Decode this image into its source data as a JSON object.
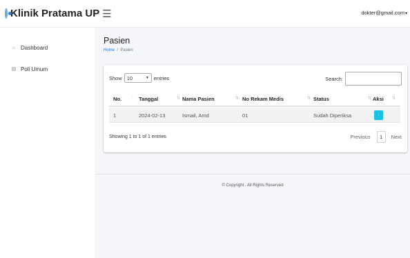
{
  "brand": {
    "name": "Klinik Pratama UP",
    "logo_icon": "clinic-logo-icon"
  },
  "header": {
    "menu_icon": "hamburger-icon",
    "user_email": "dokter@gmail.com",
    "caret": "▾"
  },
  "sidebar": {
    "items": [
      {
        "label": "Dashboard",
        "icon": "house-icon",
        "glyph": "⌂"
      },
      {
        "label": "Poli Umum",
        "icon": "document-icon",
        "glyph": "▤"
      }
    ]
  },
  "page": {
    "title": "Pasien",
    "breadcrumb": {
      "home": "Home",
      "separator": "/",
      "current": "Pasien"
    }
  },
  "table_controls": {
    "show_label": "Show",
    "length_value": "10",
    "entries_label": "entries",
    "search_label": "Search:",
    "search_value": ""
  },
  "table": {
    "columns": [
      "No.",
      "Tanggal",
      "Nama Pasien",
      "No Rekam Medis",
      "Status",
      "Aksi"
    ],
    "rows": [
      {
        "no": "1",
        "tanggal": "2024-02-13",
        "nama": "Ismail, Amd",
        "rekam_medis": "01",
        "status": "Sudah Diperiksa",
        "aksi_icon": "action-icon",
        "aksi_glyph": "↑"
      }
    ]
  },
  "pagination": {
    "info": "Showing 1 to 1 of 1 entries",
    "previous": "Previous",
    "current_page": "1",
    "next": "Next"
  },
  "footer": {
    "text": "© Copyright . All Rights Reserved"
  },
  "colors": {
    "accent": "#17c1e8",
    "link": "#007bff",
    "content_bg": "#f4f6f9"
  }
}
